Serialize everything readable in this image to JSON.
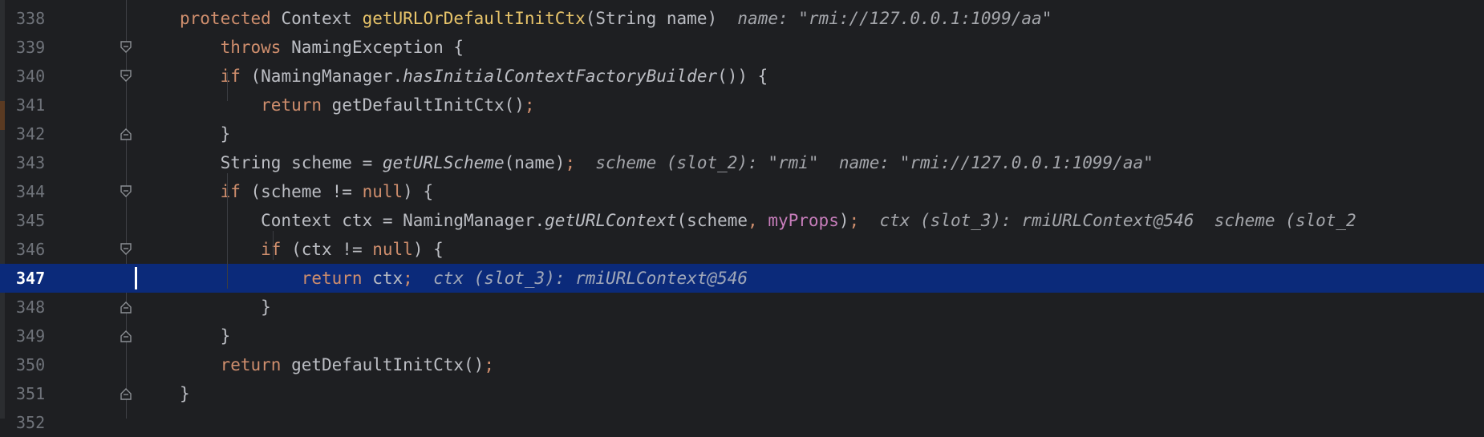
{
  "lines": [
    {
      "n": "338",
      "tokens": [
        {
          "t": "protected ",
          "c": "kw"
        },
        {
          "t": "Context ",
          "c": ""
        },
        {
          "t": "getURLOrDefaultInitCtx",
          "c": "fnd"
        },
        {
          "t": "(String name)",
          "c": ""
        },
        {
          "t": "  name: \"rmi://127.0.0.1:1099/aa\"",
          "c": "hint"
        }
      ]
    },
    {
      "n": "339",
      "tokens": [
        {
          "t": "    ",
          "c": ""
        },
        {
          "t": "throws ",
          "c": "kw"
        },
        {
          "t": "NamingException {",
          "c": ""
        }
      ]
    },
    {
      "n": "340",
      "tokens": [
        {
          "t": "    ",
          "c": ""
        },
        {
          "t": "if ",
          "c": "kw"
        },
        {
          "t": "(NamingManager.",
          "c": ""
        },
        {
          "t": "hasInitialContextFactoryBuilder",
          "c": "it"
        },
        {
          "t": "()) {",
          "c": ""
        }
      ]
    },
    {
      "n": "341",
      "tokens": [
        {
          "t": "        ",
          "c": ""
        },
        {
          "t": "return ",
          "c": "kw"
        },
        {
          "t": "getDefaultInitCtx()",
          "c": ""
        },
        {
          "t": ";",
          "c": "punc"
        }
      ]
    },
    {
      "n": "342",
      "tokens": [
        {
          "t": "    }",
          "c": ""
        }
      ]
    },
    {
      "n": "343",
      "tokens": [
        {
          "t": "    String scheme = ",
          "c": ""
        },
        {
          "t": "getURLScheme",
          "c": "it"
        },
        {
          "t": "(name)",
          "c": ""
        },
        {
          "t": ";",
          "c": "punc"
        },
        {
          "t": "  scheme (slot_2): \"rmi\"  name: \"rmi://127.0.0.1:1099/aa\"",
          "c": "hint"
        }
      ]
    },
    {
      "n": "344",
      "tokens": [
        {
          "t": "    ",
          "c": ""
        },
        {
          "t": "if ",
          "c": "kw"
        },
        {
          "t": "(scheme != ",
          "c": ""
        },
        {
          "t": "null",
          "c": "kw"
        },
        {
          "t": ") {",
          "c": ""
        }
      ]
    },
    {
      "n": "345",
      "tokens": [
        {
          "t": "        Context ctx = NamingManager.",
          "c": ""
        },
        {
          "t": "getURLContext",
          "c": "it"
        },
        {
          "t": "(scheme",
          "c": ""
        },
        {
          "t": ", ",
          "c": "punc"
        },
        {
          "t": "myProps",
          "c": "fld"
        },
        {
          "t": ")",
          "c": ""
        },
        {
          "t": ";",
          "c": "punc"
        },
        {
          "t": "  ctx (slot_3): rmiURLContext@546  scheme (slot_2",
          "c": "hint"
        }
      ]
    },
    {
      "n": "346",
      "tokens": [
        {
          "t": "        ",
          "c": ""
        },
        {
          "t": "if ",
          "c": "kw"
        },
        {
          "t": "(ctx != ",
          "c": ""
        },
        {
          "t": "null",
          "c": "kw"
        },
        {
          "t": ") {",
          "c": ""
        }
      ]
    },
    {
      "n": "347",
      "tokens": [
        {
          "t": "            ",
          "c": ""
        },
        {
          "t": "return ",
          "c": "kw"
        },
        {
          "t": "ctx",
          "c": ""
        },
        {
          "t": ";",
          "c": "punc"
        },
        {
          "t": "  ctx (slot_3): rmiURLContext@546",
          "c": "hint"
        }
      ]
    },
    {
      "n": "348",
      "tokens": [
        {
          "t": "        }",
          "c": ""
        }
      ]
    },
    {
      "n": "349",
      "tokens": [
        {
          "t": "    }",
          "c": ""
        }
      ]
    },
    {
      "n": "350",
      "tokens": [
        {
          "t": "    ",
          "c": ""
        },
        {
          "t": "return ",
          "c": "kw"
        },
        {
          "t": "getDefaultInitCtx()",
          "c": ""
        },
        {
          "t": ";",
          "c": "punc"
        }
      ]
    },
    {
      "n": "351",
      "tokens": [
        {
          "t": "}",
          "c": ""
        }
      ]
    },
    {
      "n": "352",
      "tokens": []
    }
  ],
  "current_line": "347",
  "fold_markers": {
    "339": "open",
    "340": "open",
    "342": "close",
    "344": "open",
    "346": "open",
    "348": "close",
    "349": "close",
    "351": "close"
  },
  "colors": {
    "background": "#1e1f22",
    "current_line": "#0b2a7a",
    "keyword": "#cf8e6d",
    "method_decl": "#e8c46a",
    "field": "#c77dbb"
  }
}
